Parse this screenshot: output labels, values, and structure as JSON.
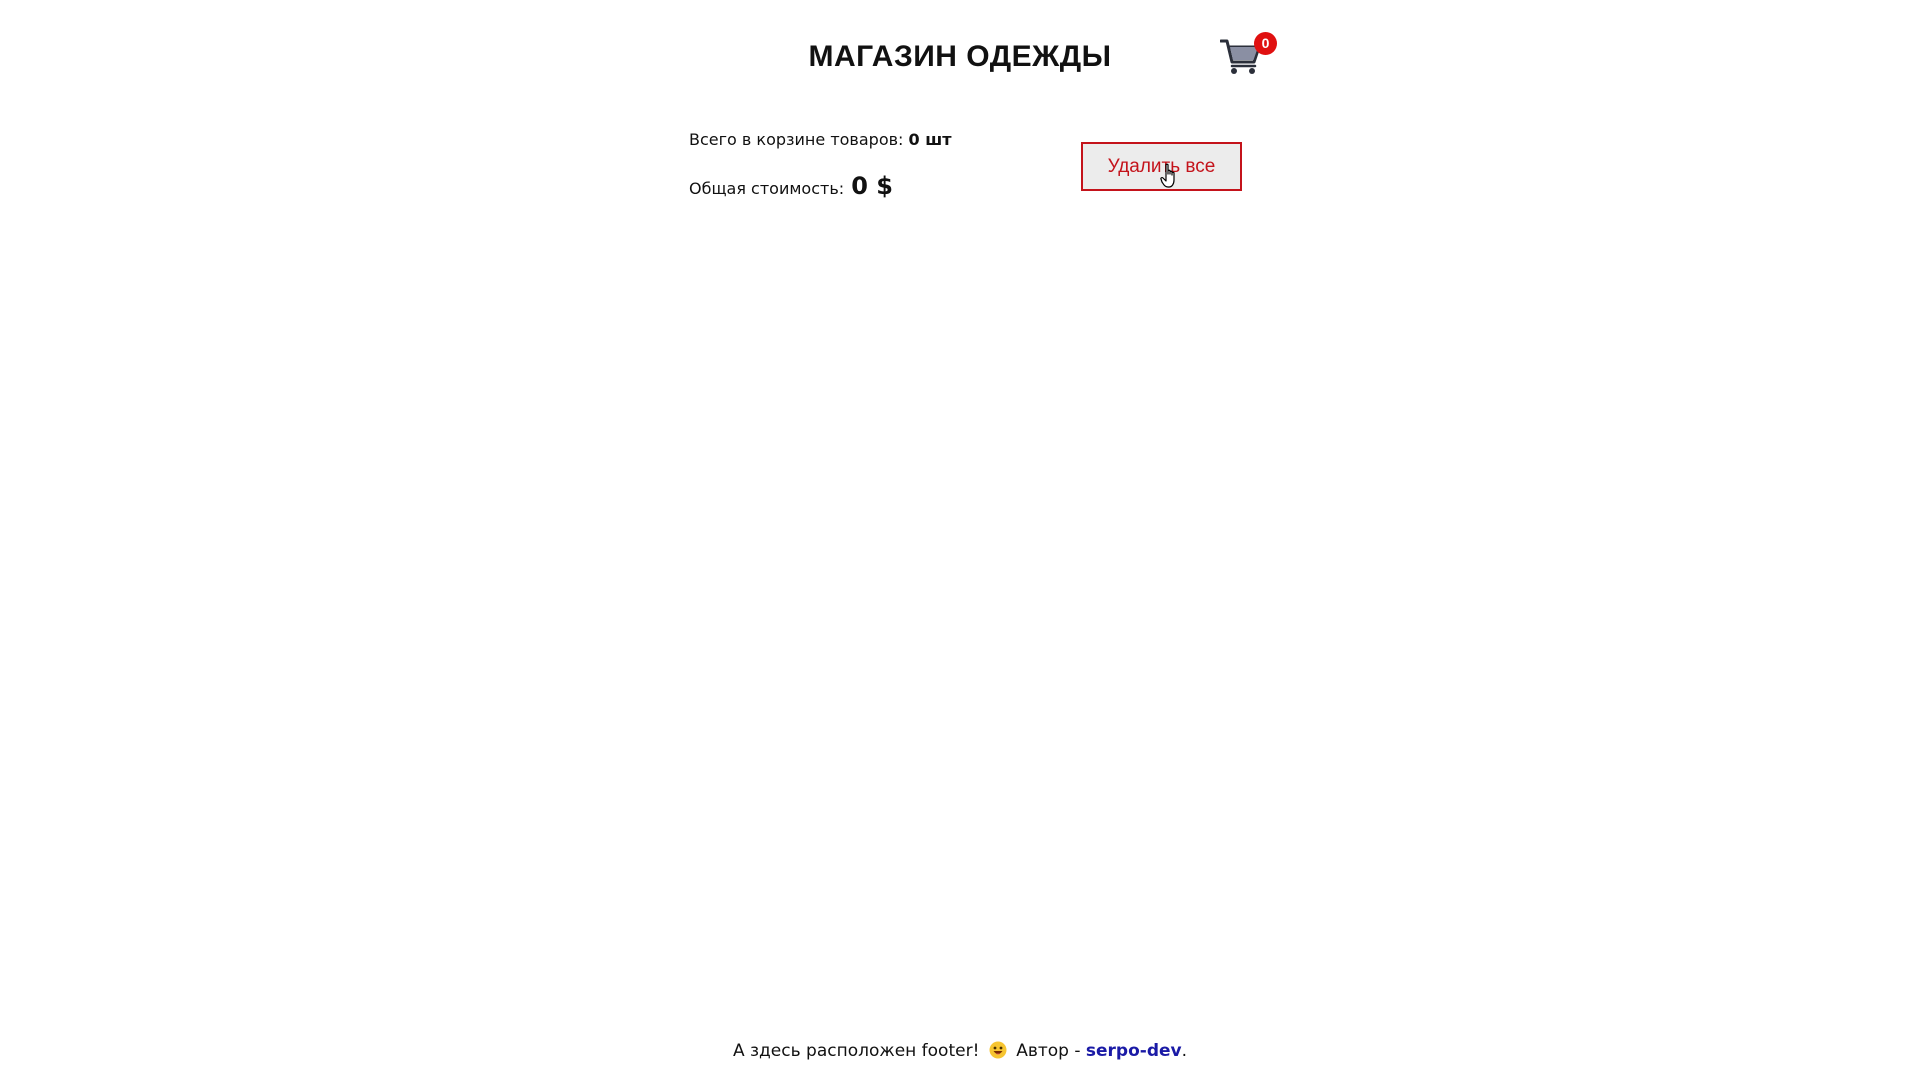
{
  "header": {
    "title": "МАГАЗИН ОДЕЖДЫ",
    "cart": {
      "icon": "cart-icon",
      "badge_count": "0",
      "badge_color": "#e01010"
    }
  },
  "summary": {
    "count_label": "Всего в корзине товаров: ",
    "count_value": "0 шт",
    "total_label": "Общая стоимость: ",
    "total_value": "0 $"
  },
  "actions": {
    "delete_all_label": "Удалить все",
    "delete_all_color": "#c4131b"
  },
  "footer": {
    "text_before": "А здесь расположен footer!",
    "emoji": "smiling-face-icon",
    "author_prefix": "Автор - ",
    "author_name": "serpo-dev",
    "text_after": "."
  }
}
